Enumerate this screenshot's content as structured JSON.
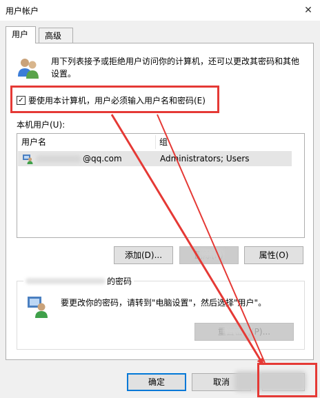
{
  "window": {
    "title": "用户帐户",
    "close_glyph": "✕"
  },
  "tabs": [
    {
      "label": "用户",
      "active": true
    },
    {
      "label": "高级",
      "active": false
    }
  ],
  "description": "用下列表接予或拒绝用户访问你的计算机，还可以更改其密码和其他设置。",
  "require_login": {
    "label": "要使用本计算机，用户必须输入用户名和密码(E)",
    "checked": true,
    "check_glyph": "✓"
  },
  "local_users": {
    "label": "本机用户(U):",
    "columns": [
      "用户名",
      "组"
    ],
    "rows": [
      {
        "name": "@qq.com",
        "group": "Administrators; Users"
      }
    ]
  },
  "buttons": {
    "add": "添加(D)...",
    "remove": "删除(R)",
    "properties": "属性(O)"
  },
  "password_group": {
    "title": "的密码",
    "text": "要更改你的密码，请转到\"电脑设置\"，然后选择\"用户\"。",
    "reset_button": "重置密码(P)..."
  },
  "dialog_buttons": {
    "ok": "确定",
    "cancel": "取消"
  },
  "colors": {
    "highlight_red": "#e53935",
    "focus_blue": "#0078d7",
    "selected_row": "#e5e5e5"
  }
}
